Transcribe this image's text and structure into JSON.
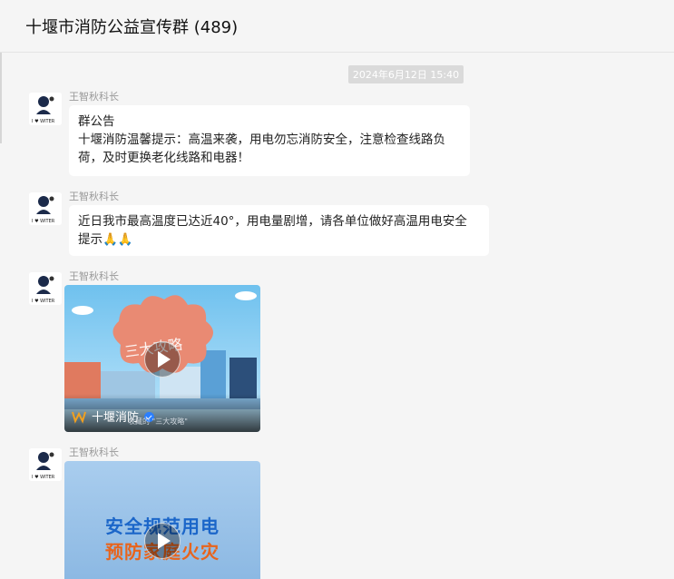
{
  "header": {
    "title": "十堰市消防公益宣传群 (489)"
  },
  "timestamp": "2024年6月12日 15:40",
  "messages": [
    {
      "sender": "王智秋科长",
      "lines": [
        "群公告",
        "十堰消防温馨提示：高温来袭，用电勿忘消防安全，注意检查线路负",
        "荷，及时更换老化线路和电器！"
      ]
    },
    {
      "sender": "王智秋科长",
      "lines": [
        "近日我市最高温度已达近40°，用电量剧增，请各单位做好高温用电安全",
        "提示🙏🙏"
      ]
    },
    {
      "sender": "王智秋科长",
      "video": {
        "overlay_text": "三大攻略",
        "brand": "十堰消防",
        "caption": "收藏的 \"三大攻略\""
      }
    },
    {
      "sender": "王智秋科长",
      "video": {
        "line1": "安全规范用电",
        "line2": "预防家庭火灾"
      }
    }
  ],
  "avatar_text": "I ♥ WITER",
  "colors": {
    "accent_blue": "#2a7fff",
    "bubble": "#ffffff",
    "bg": "#f5f5f5"
  }
}
